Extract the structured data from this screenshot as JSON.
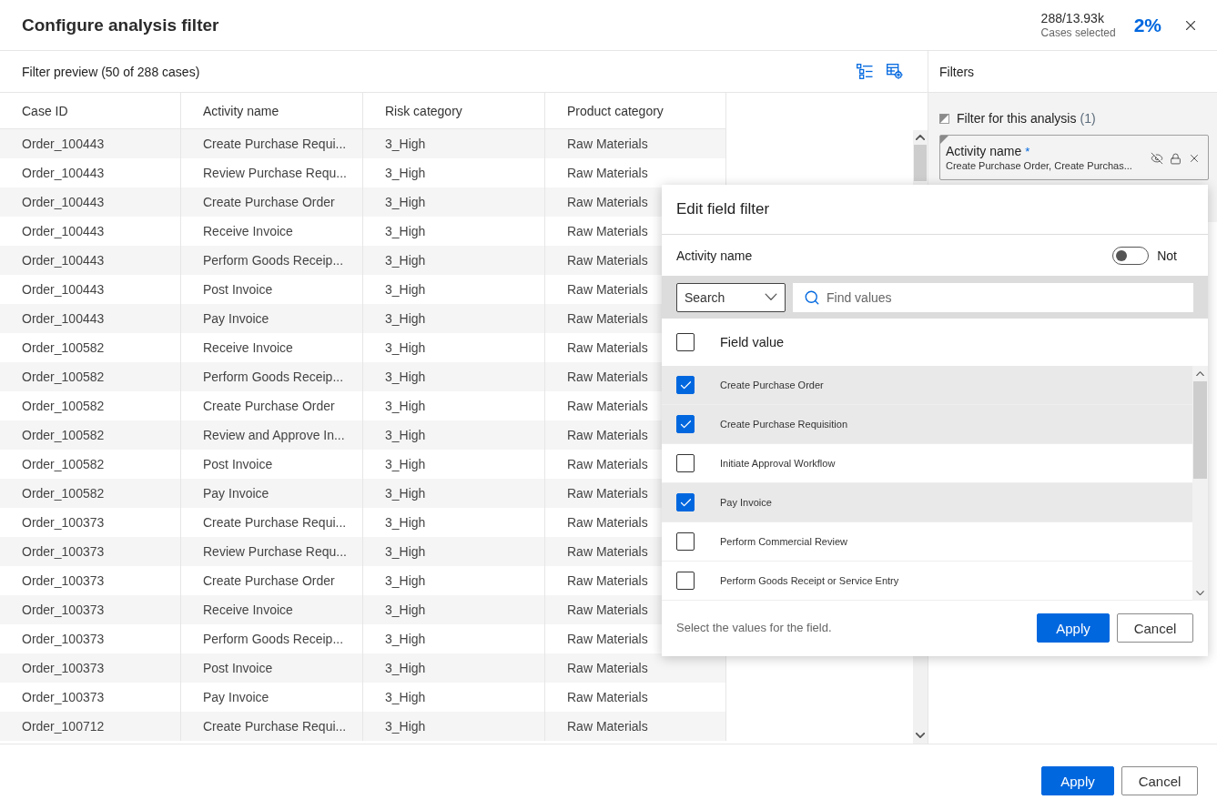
{
  "window": {
    "title": "Configure analysis filter"
  },
  "summary": {
    "count": "288/13.93k",
    "label": "Cases selected",
    "percent": "2%"
  },
  "preview": {
    "title": "Filter preview (50 of 288 cases)"
  },
  "table": {
    "columns": [
      "Case ID",
      "Activity name",
      "Risk category",
      "Product category"
    ],
    "rows": [
      [
        "Order_100443",
        "Create Purchase Requi...",
        "3_High",
        "Raw Materials"
      ],
      [
        "Order_100443",
        "Review Purchase Requ...",
        "3_High",
        "Raw Materials"
      ],
      [
        "Order_100443",
        "Create Purchase Order",
        "3_High",
        "Raw Materials"
      ],
      [
        "Order_100443",
        "Receive Invoice",
        "3_High",
        "Raw Materials"
      ],
      [
        "Order_100443",
        "Perform Goods Receip...",
        "3_High",
        "Raw Materials"
      ],
      [
        "Order_100443",
        "Post Invoice",
        "3_High",
        "Raw Materials"
      ],
      [
        "Order_100443",
        "Pay Invoice",
        "3_High",
        "Raw Materials"
      ],
      [
        "Order_100582",
        "Receive Invoice",
        "3_High",
        "Raw Materials"
      ],
      [
        "Order_100582",
        "Perform Goods Receip...",
        "3_High",
        "Raw Materials"
      ],
      [
        "Order_100582",
        "Create Purchase Order",
        "3_High",
        "Raw Materials"
      ],
      [
        "Order_100582",
        "Review and Approve In...",
        "3_High",
        "Raw Materials"
      ],
      [
        "Order_100582",
        "Post Invoice",
        "3_High",
        "Raw Materials"
      ],
      [
        "Order_100582",
        "Pay Invoice",
        "3_High",
        "Raw Materials"
      ],
      [
        "Order_100373",
        "Create Purchase Requi...",
        "3_High",
        "Raw Materials"
      ],
      [
        "Order_100373",
        "Review Purchase Requ...",
        "3_High",
        "Raw Materials"
      ],
      [
        "Order_100373",
        "Create Purchase Order",
        "3_High",
        "Raw Materials"
      ],
      [
        "Order_100373",
        "Receive Invoice",
        "3_High",
        "Raw Materials"
      ],
      [
        "Order_100373",
        "Perform Goods Receip...",
        "3_High",
        "Raw Materials"
      ],
      [
        "Order_100373",
        "Post Invoice",
        "3_High",
        "Raw Materials"
      ],
      [
        "Order_100373",
        "Pay Invoice",
        "3_High",
        "Raw Materials"
      ],
      [
        "Order_100712",
        "Create Purchase Requi...",
        "3_High",
        "Raw Materials"
      ]
    ]
  },
  "filters": {
    "title": "Filters",
    "group": {
      "label": "Filter for this analysis",
      "count": "(1)"
    },
    "cards": [
      {
        "title": "Activity name",
        "marker": "*",
        "summary": "Create Purchase Order, Create Purchas..."
      }
    ]
  },
  "edit_filter": {
    "title": "Edit field filter",
    "field": "Activity name",
    "not_toggle": {
      "label": "Not",
      "on": false
    },
    "mode": "Search",
    "search": {
      "placeholder": "Find values"
    },
    "select_all": {
      "label": "Field value",
      "checked": false
    },
    "values": [
      {
        "label": "Create Purchase Order",
        "checked": true
      },
      {
        "label": "Create Purchase Requisition",
        "checked": true
      },
      {
        "label": "Initiate Approval Workflow",
        "checked": false
      },
      {
        "label": "Pay Invoice",
        "checked": true
      },
      {
        "label": "Perform Commercial Review",
        "checked": false
      },
      {
        "label": "Perform Goods Receipt or Service Entry",
        "checked": false
      }
    ],
    "hint": "Select the values for the field.",
    "buttons": [
      {
        "label": "Apply",
        "kind": "primary"
      },
      {
        "label": "Cancel",
        "kind": "secondary"
      }
    ]
  },
  "footer": {
    "buttons": [
      {
        "label": "Apply",
        "kind": "primary"
      },
      {
        "label": "Cancel",
        "kind": "secondary"
      }
    ]
  }
}
